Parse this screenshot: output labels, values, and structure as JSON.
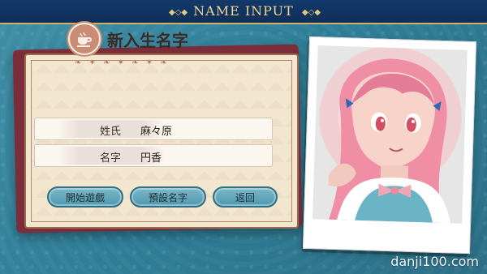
{
  "header": {
    "title": "NAME INPUT"
  },
  "card": {
    "title": "新入生名字",
    "fields": [
      {
        "label": "姓氏",
        "value": "麻々原"
      },
      {
        "label": "名字",
        "value": "円香"
      }
    ],
    "buttons": [
      {
        "label": "開始遊戲"
      },
      {
        "label": "預設名字"
      },
      {
        "label": "返回"
      }
    ]
  },
  "watermark": "danji100.com",
  "colors": {
    "background": "#2f7f99",
    "header": "#0f2f58",
    "header_text": "#f1d89b",
    "card": "#f3e6cf",
    "button": "#4f97ad"
  },
  "icons": {
    "teacup": "teacup-icon",
    "ornament": "ornament-icon"
  }
}
